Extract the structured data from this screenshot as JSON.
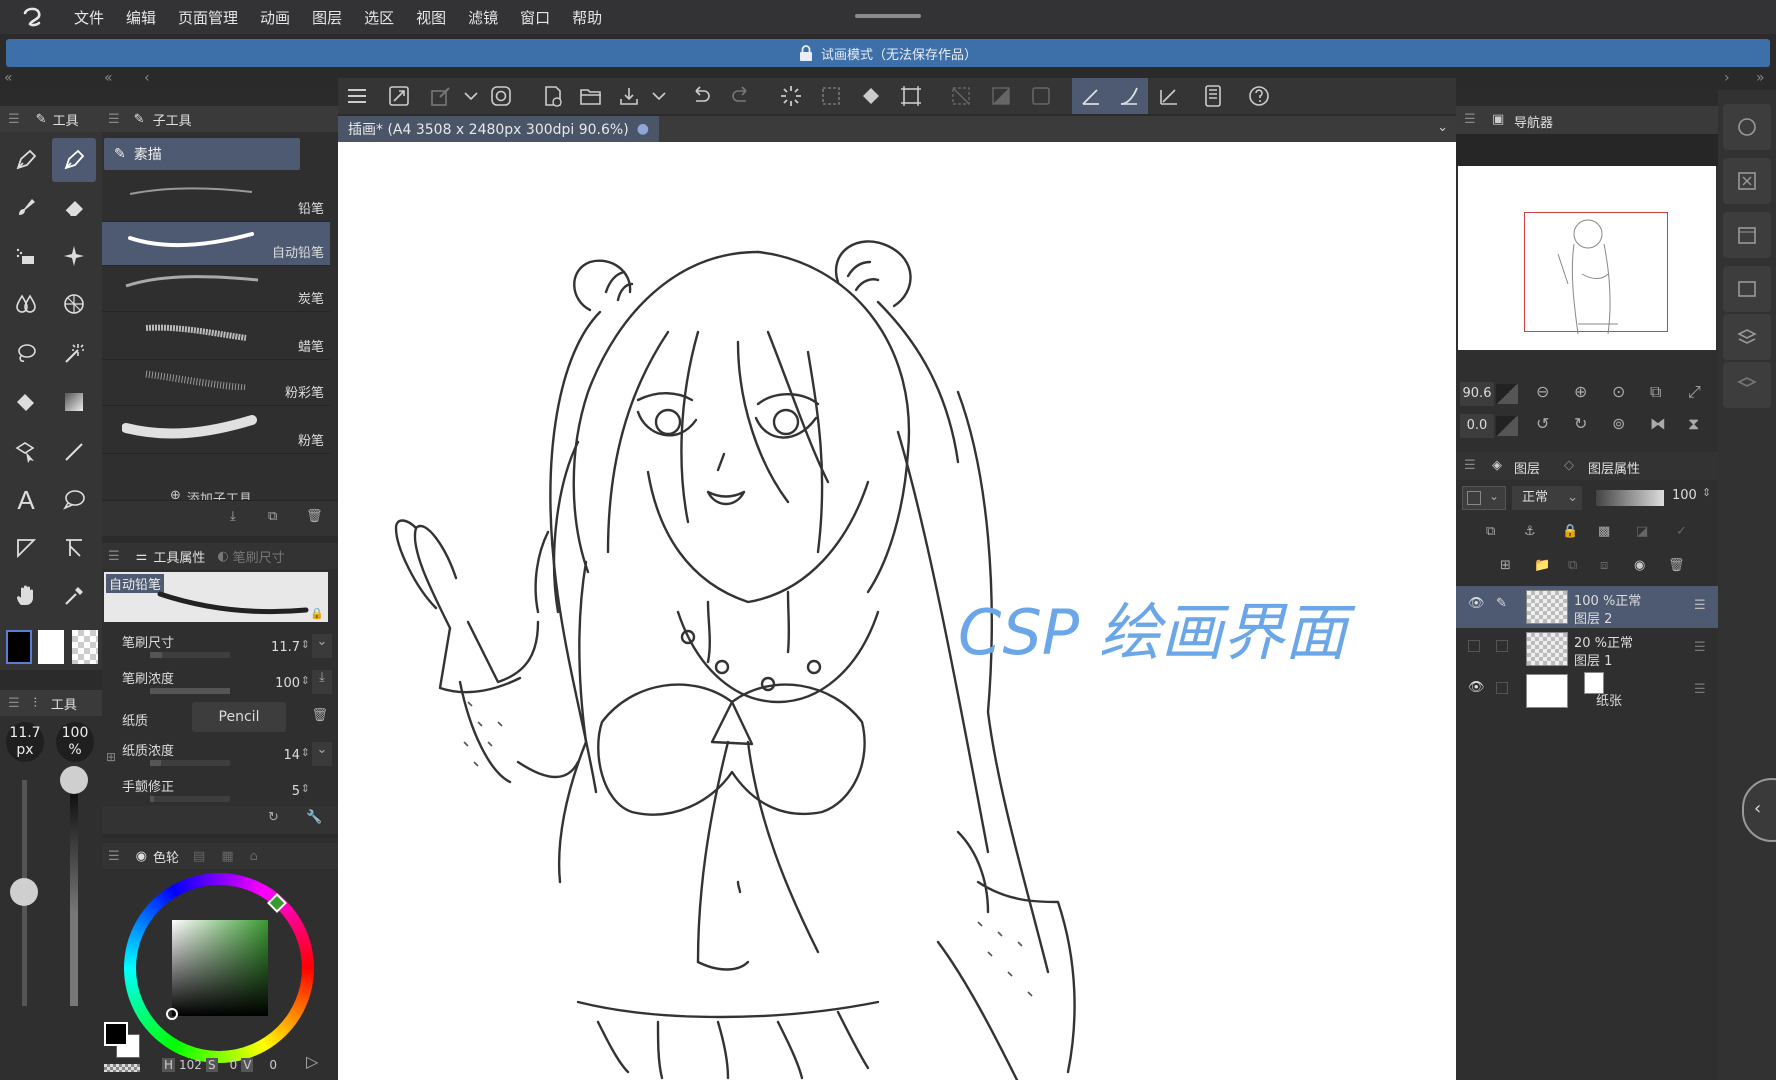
{
  "menu": [
    "文件",
    "编辑",
    "页面管理",
    "动画",
    "图层",
    "选区",
    "视图",
    "滤镜",
    "窗口",
    "帮助"
  ],
  "banner": {
    "text": "试画模式（无法保存作品）"
  },
  "tool_panel": {
    "title": "工具",
    "bottom_title": "工具",
    "size_value": "11.7",
    "size_unit": "px",
    "opacity_value": "100",
    "opacity_unit": "%"
  },
  "subtool_panel": {
    "title": "子工具",
    "group": "素描",
    "add_label": "添加子工具",
    "brushes": [
      {
        "label": "铅笔"
      },
      {
        "label": "自动铅笔"
      },
      {
        "label": "炭笔"
      },
      {
        "label": "蜡笔"
      },
      {
        "label": "粉彩笔"
      },
      {
        "label": "粉笔"
      }
    ],
    "selected_index": 1
  },
  "tool_property": {
    "tab_active": "工具属性",
    "tab_inactive": "笔刷尺寸",
    "preview_label": "自动铅笔",
    "rows": [
      {
        "name": "笔刷尺寸",
        "value": "11.7",
        "fill": 0.15
      },
      {
        "name": "笔刷浓度",
        "value": "100",
        "fill": 1.0
      },
      {
        "name": "纸质",
        "value": "Pencil"
      },
      {
        "name": "纸质浓度",
        "value": "14",
        "fill": 0.14
      },
      {
        "name": "手颤修正",
        "value": "5",
        "fill": 0.05
      }
    ]
  },
  "color_panel": {
    "title": "色轮",
    "h_label": "H",
    "h_value": "102",
    "s_label": "S",
    "s_value": "0",
    "v_label": "V",
    "v_value": "0",
    "hue_color": "#3a9a32"
  },
  "canvas": {
    "tab_title": "插画* (A4 3508 x 2480px 300dpi 90.6%)",
    "watermark": "CSP 绘画界面",
    "watermark_color": "#6aa6e8"
  },
  "navigator": {
    "title": "导航器",
    "zoom": "90.6",
    "rotation": "0.0"
  },
  "layer_panel": {
    "tab_layers": "图层",
    "tab_props": "图层属性",
    "blend_mode": "正常",
    "opacity": "100",
    "layers": [
      {
        "mode": "100 %正常",
        "name": "图层 2",
        "visible": true,
        "selected": true
      },
      {
        "mode": "20 %正常",
        "name": "图层 1",
        "visible": false,
        "selected": false
      },
      {
        "mode": "",
        "name": "纸张",
        "visible": true,
        "selected": false
      }
    ]
  },
  "colors": {
    "accent": "#4e5a72",
    "banner": "#3d6fa8",
    "main_color": "#000000",
    "sub_color": "#ffffff"
  }
}
